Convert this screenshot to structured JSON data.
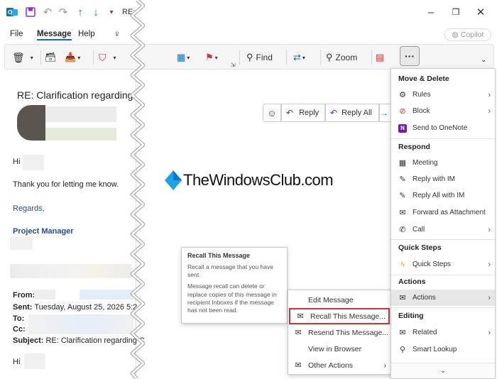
{
  "titlebar": {
    "title_fragment": "RE:",
    "copilot_label": "Copilot"
  },
  "menubar": {
    "file": "File",
    "message": "Message",
    "help": "Help"
  },
  "ribbon": {
    "find": "Find",
    "zoom": "Zoom"
  },
  "email": {
    "subject_heading": "RE: Clarification regarding",
    "greeting": "Hi",
    "body": "Thank you for letting me know.",
    "regards": "Regards,",
    "role": "Project Manager",
    "from_label": "From:",
    "sent_label": "Sent:",
    "sent_value": "Tuesday, August 25, 2026 5:2",
    "to_label": "To:",
    "cc_label": "Cc:",
    "subject_label": "Subject:",
    "subject_value": "RE: Clarification regarding C",
    "greeting2": "Hi"
  },
  "reading": {
    "reply": "Reply",
    "reply_all": "Reply All",
    "watermark": "TheWindowsClub.com"
  },
  "tooltip": {
    "title": "Recall This Message",
    "line1": "Recall a message that you have sent.",
    "line2": "Message recall can delete or replace copies of this message in recipient Inboxes if the message has not been read."
  },
  "submenu": {
    "items": [
      {
        "label": "Edit Message"
      },
      {
        "label": "Recall This Message..."
      },
      {
        "label": "Resend This Message..."
      },
      {
        "label": "View in Browser"
      },
      {
        "label": "Other Actions"
      }
    ]
  },
  "dropdown": {
    "sections": {
      "move_delete": "Move & Delete",
      "respond": "Respond",
      "quick_steps": "Quick Steps",
      "actions": "Actions",
      "editing": "Editing"
    },
    "items": {
      "rules": "Rules",
      "block": "Block",
      "onenote": "Send to OneNote",
      "meeting": "Meeting",
      "reply_im": "Reply with IM",
      "reply_all_im": "Reply All with IM",
      "forward_attachment": "Forward as Attachment",
      "call": "Call",
      "quick_steps": "Quick Steps",
      "actions": "Actions",
      "related": "Related",
      "smart_lookup": "Smart Lookup"
    }
  },
  "colors": {
    "accent": "#0f6cbd",
    "highlight_red": "#d13438",
    "purple": "#7719aa",
    "signature_blue": "#1f4e9c"
  }
}
